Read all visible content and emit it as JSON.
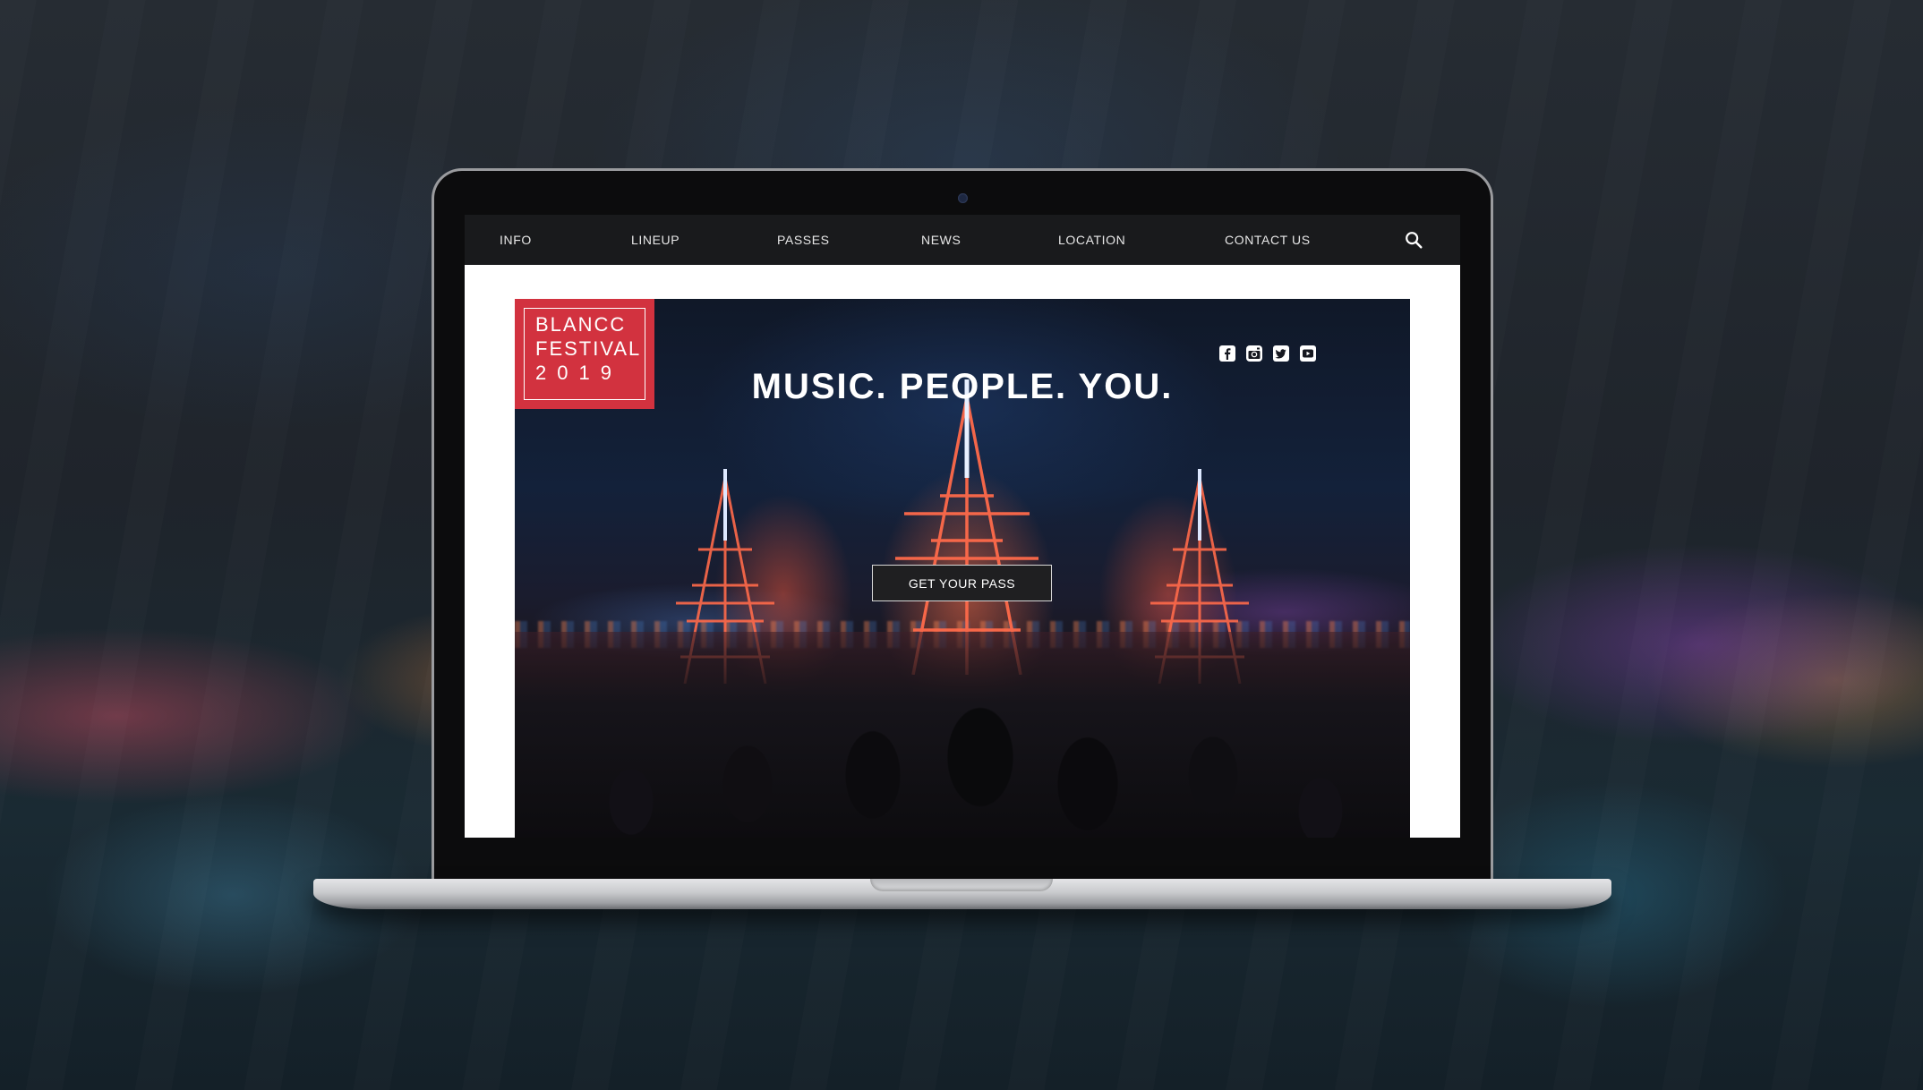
{
  "nav": {
    "items": [
      {
        "label": "INFO"
      },
      {
        "label": "LINEUP"
      },
      {
        "label": "PASSES"
      },
      {
        "label": "NEWS"
      },
      {
        "label": "LOCATION"
      },
      {
        "label": "CONTACT US"
      }
    ],
    "search_icon": "search-icon"
  },
  "logo": {
    "line1": "BLANCC",
    "line2": "FESTIVAL",
    "line3": "2019",
    "background": "#d2323f"
  },
  "hero": {
    "headline": "MUSIC. PEOPLE. YOU.",
    "cta_label": "GET YOUR PASS"
  },
  "social": [
    "facebook-icon",
    "instagram-icon",
    "twitter-icon",
    "youtube-icon"
  ]
}
